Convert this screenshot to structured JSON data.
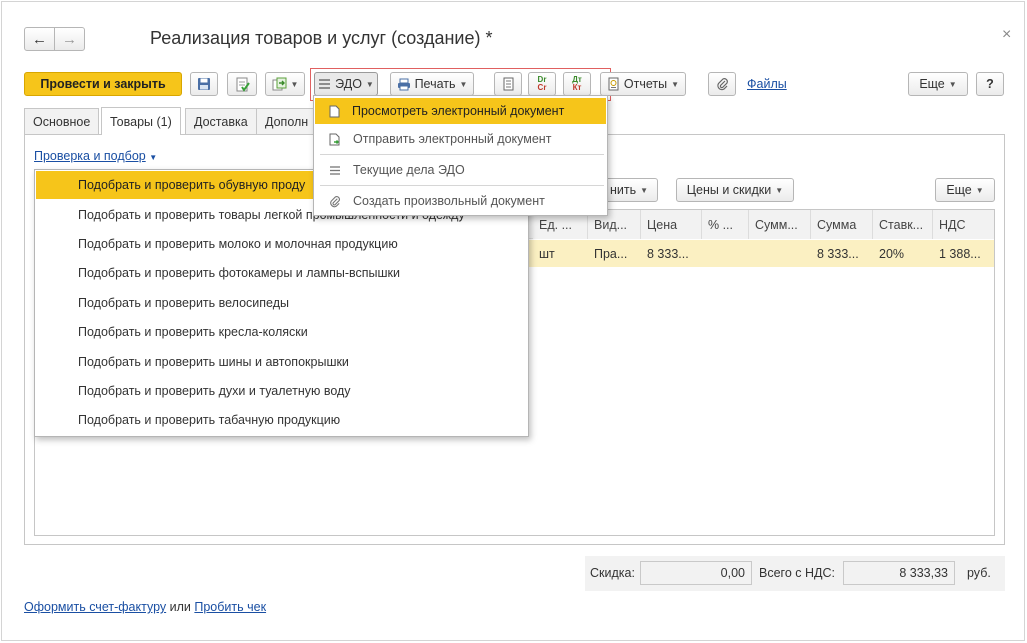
{
  "window": {
    "title": "Реализация товаров и услуг (создание) *",
    "back_glyph": "←",
    "forward_glyph": "→",
    "close_glyph": "×"
  },
  "toolbar": {
    "post_close_label": "Провести и закрыть",
    "edo_label": "ЭДО",
    "print_label": "Печать",
    "reports_label": "Отчеты",
    "files_label": "Файлы",
    "more_label": "Еще",
    "help_label": "?",
    "dtkt_top": "Dr",
    "dtkt_bottom": "Cr",
    "dtkt2_top": "Дт",
    "dtkt2_bottom": "Кт"
  },
  "tabs": [
    {
      "label": "Основное"
    },
    {
      "label": "Товары (1)"
    },
    {
      "label": "Доставка"
    },
    {
      "label": "Дополн"
    }
  ],
  "goods": {
    "check_select_label": "Проверка и подбор",
    "fill_label": "нить",
    "prices_label": "Цены и скидки",
    "more_label": "Еще",
    "columns": [
      "Ед. ...",
      "Вид...",
      "Цена",
      "% ...",
      "Сумм...",
      "Сумма",
      "Ставк...",
      "НДС"
    ],
    "row": [
      "шт",
      "Пра...",
      "8 333...",
      "",
      "",
      "8 333...",
      "20%",
      "1 388..."
    ]
  },
  "check_menu": {
    "items": [
      "Подобрать и проверить обувную проду",
      "Подобрать и проверить товары легкой промышленности и одежду",
      "Подобрать и проверить молоко и молочная продукцию",
      "Подобрать и проверить фотокамеры и лампы-вспышки",
      "Подобрать и проверить велосипеды",
      "Подобрать и проверить кресла-коляски",
      "Подобрать и проверить шины и автопокрышки",
      "Подобрать и проверить духи и туалетную воду",
      "Подобрать и проверить табачную продукцию"
    ]
  },
  "edo_menu": {
    "items": [
      {
        "label": "Просмотреть электронный документ",
        "icon": "document-icon"
      },
      {
        "label": "Отправить электронный документ",
        "icon": "send-document-icon"
      },
      {
        "label": "Текущие дела ЭДО",
        "icon": "list-icon"
      },
      {
        "label": "Создать произвольный документ",
        "icon": "paperclip-icon"
      }
    ]
  },
  "totals": {
    "discount_label": "Скидка:",
    "discount_value": "0,00",
    "total_label": "Всего с НДС:",
    "total_value": "8 333,33",
    "currency": "руб."
  },
  "footer": {
    "invoice_link": "Оформить счет-фактуру",
    "or_text": "или",
    "check_link": "Пробить чек"
  },
  "colors": {
    "accent_yellow": "#f6c51a",
    "highlight_row": "#fbf0c2",
    "link": "#1a4fa3",
    "focus_red": "#e06060"
  }
}
